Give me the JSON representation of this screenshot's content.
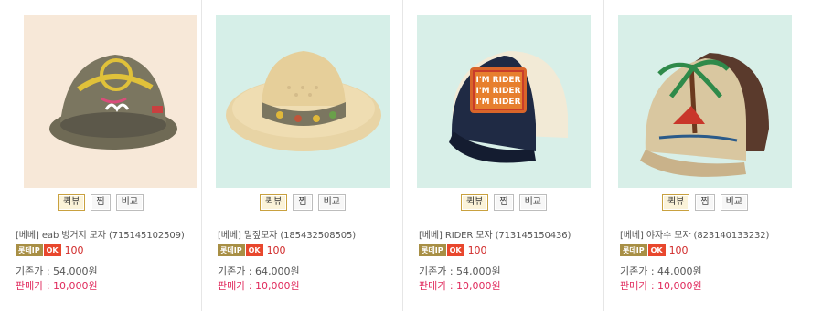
{
  "products": [
    {
      "name": "[베베] eab 벙거지 모자 (715145102509)",
      "quick_label": "퀵뷰",
      "wish_label": "찜",
      "compare_label": "비교",
      "badge_lp": "롯데IP",
      "badge_ok": "OK",
      "points": "100",
      "original_price_label": "기존가 : 54,000원",
      "sale_price_label": "판매가 : 10,000원",
      "bg": "#f7e8d8"
    },
    {
      "name": "[베베] 밀짚모자 (185432508505)",
      "quick_label": "퀵뷰",
      "wish_label": "찜",
      "compare_label": "비교",
      "badge_lp": "롯데IP",
      "badge_ok": "OK",
      "points": "100",
      "original_price_label": "기존가 : 64,000원",
      "sale_price_label": "판매가 : 10,000원",
      "bg": "#d6efe8"
    },
    {
      "name": "[베베] RIDER 모자 (713145150436)",
      "quick_label": "퀵뷰",
      "wish_label": "찜",
      "compare_label": "비교",
      "badge_lp": "롯데IP",
      "badge_ok": "OK",
      "points": "100",
      "original_price_label": "기존가 : 54,000원",
      "sale_price_label": "판매가 : 10,000원",
      "bg": "#d8efe8"
    },
    {
      "name": "[베베] 야자수 모자 (823140133232)",
      "quick_label": "퀵뷰",
      "wish_label": "찜",
      "compare_label": "비교",
      "badge_lp": "롯데IP",
      "badge_ok": "OK",
      "points": "100",
      "original_price_label": "기존가 : 44,000원",
      "sale_price_label": "판매가 : 10,000원",
      "bg": "#d8efe8"
    }
  ],
  "hat3_patch_text": [
    "I'M RIDER",
    "I'M RIDER",
    "I'M RIDER"
  ],
  "colors": {
    "sale": "#e02a5c",
    "points": "#d12a2a",
    "lp_badge": "#a88f45",
    "ok_badge": "#e8472d"
  }
}
